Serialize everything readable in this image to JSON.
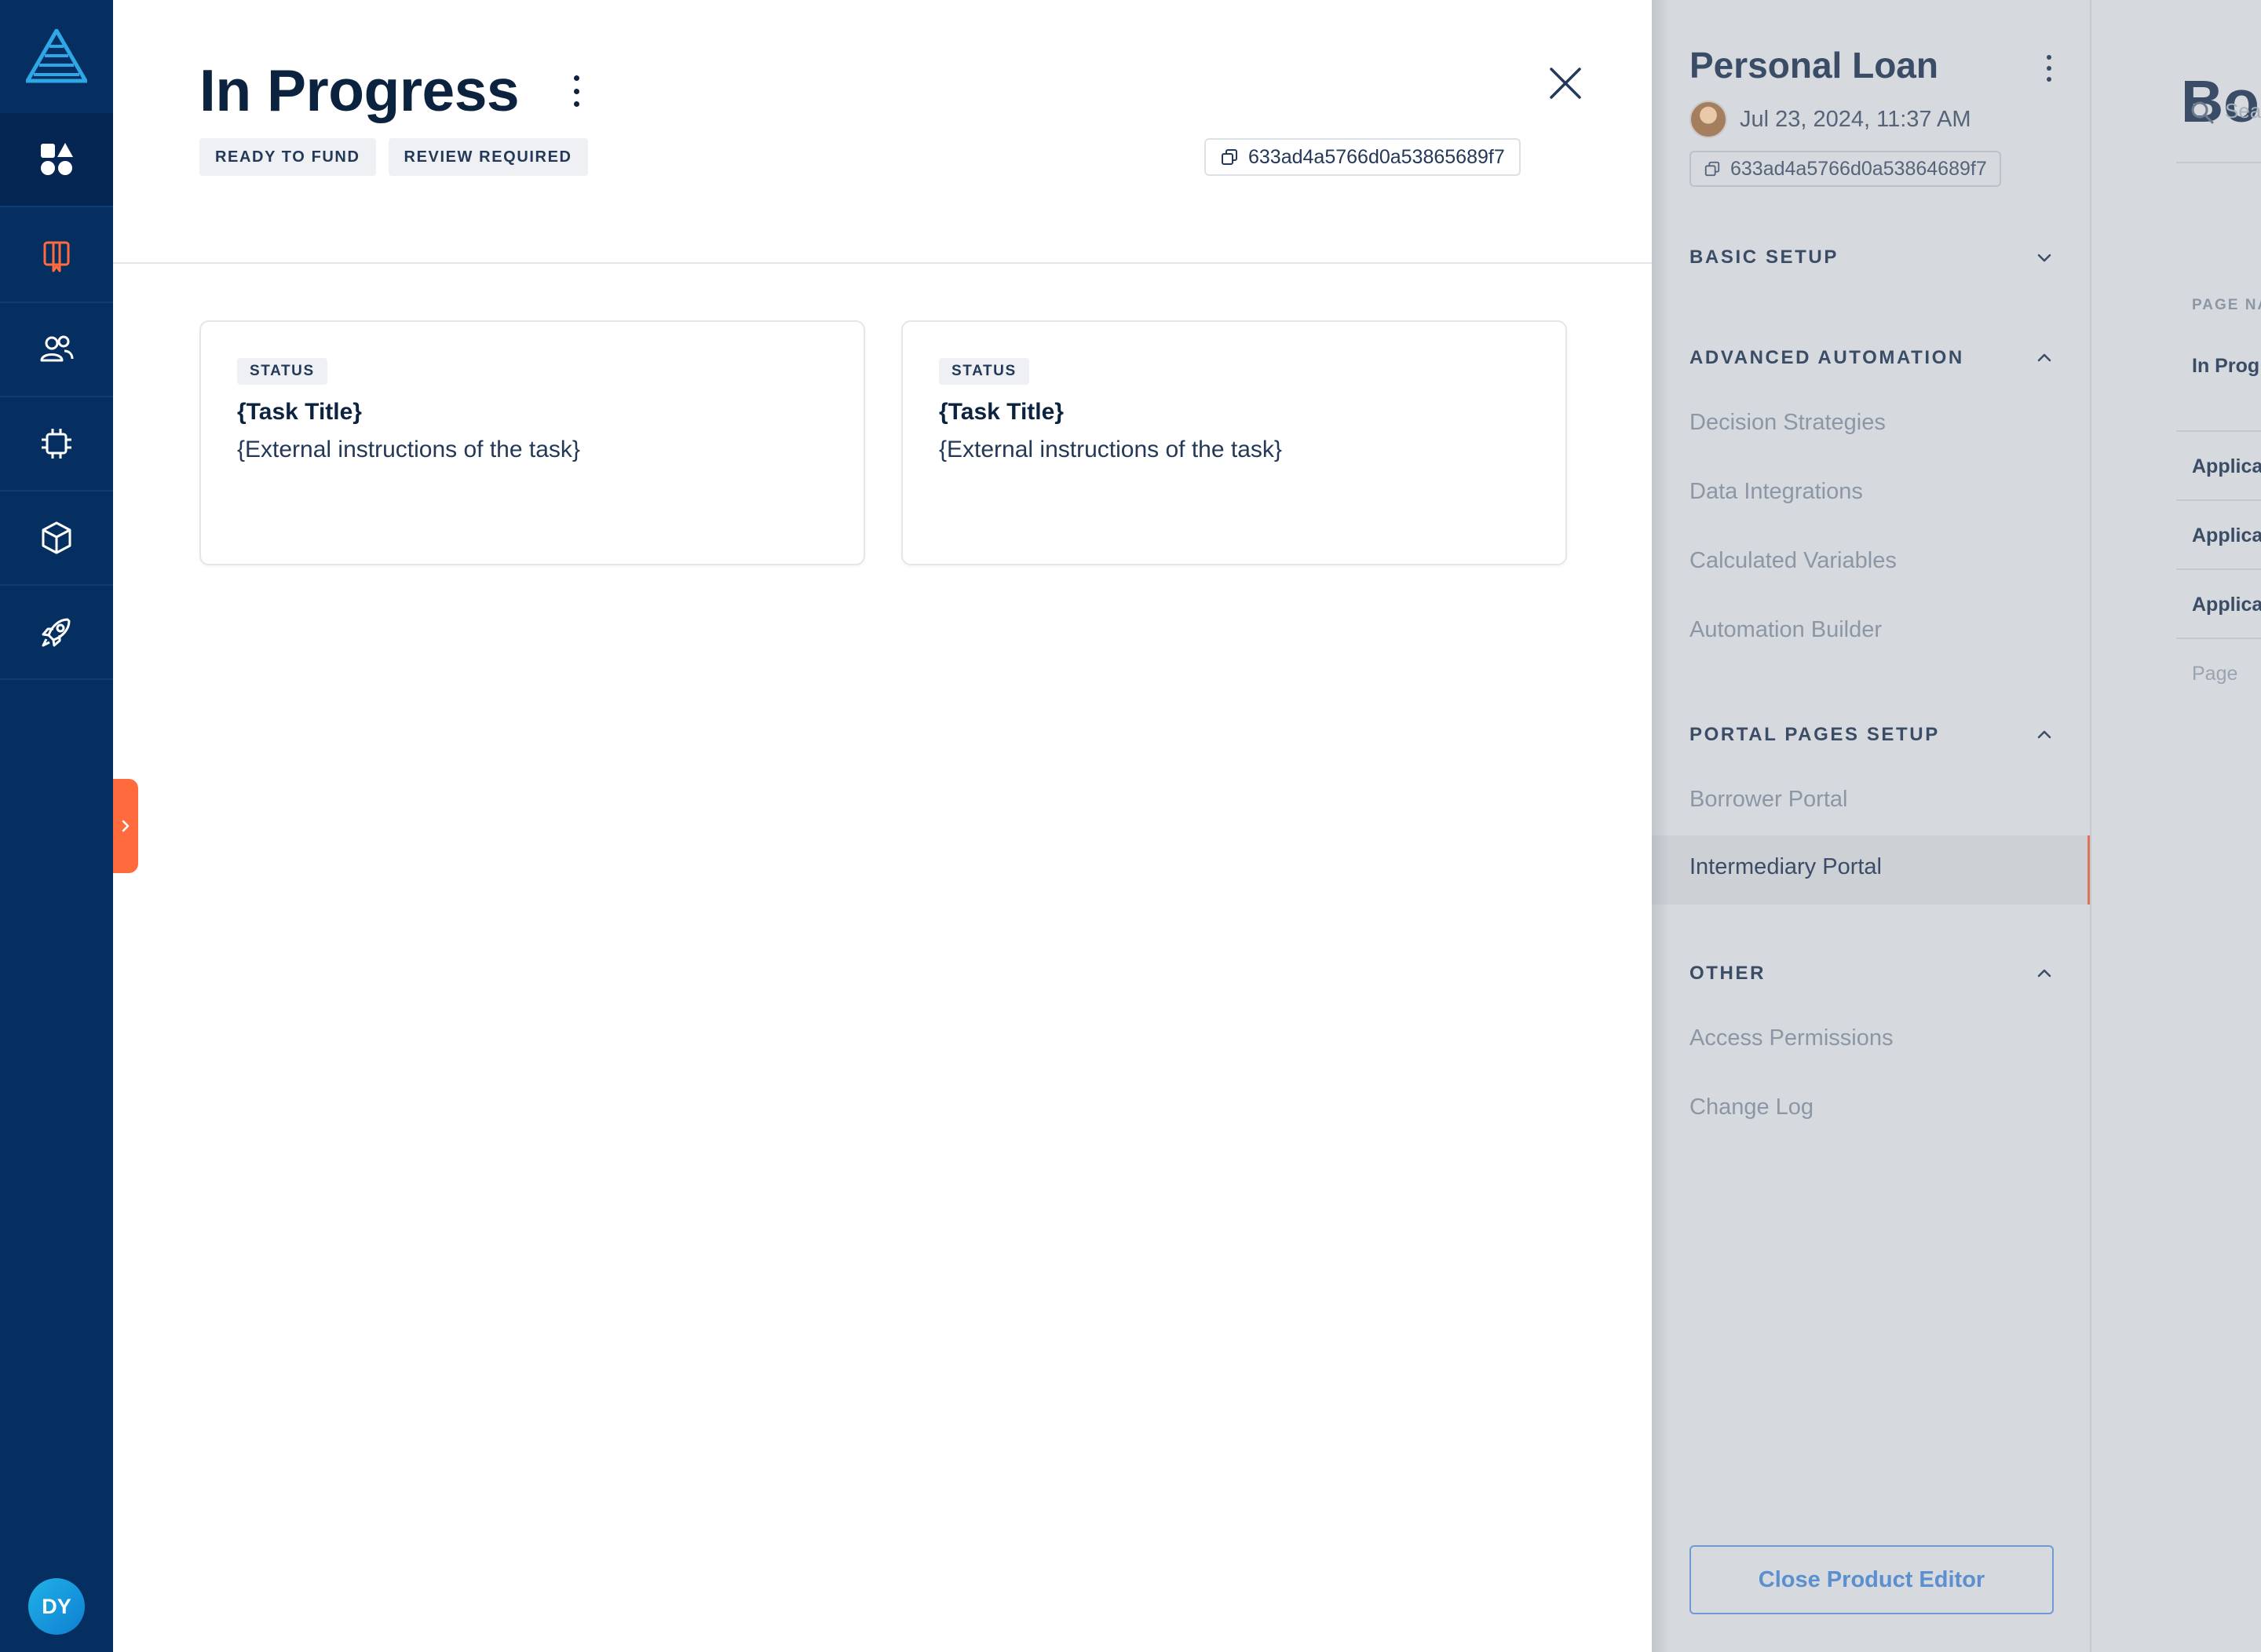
{
  "user": {
    "initials": "DY"
  },
  "modal": {
    "title": "In Progress",
    "badges": [
      "READY TO FUND",
      "REVIEW REQUIRED"
    ],
    "id": "633ad4a5766d0a53865689f7",
    "cards": [
      {
        "status": "STATUS",
        "title": "{Task Title}",
        "description": "{External instructions of the task}"
      },
      {
        "status": "STATUS",
        "title": "{Task Title}",
        "description": "{External instructions of the task}"
      }
    ]
  },
  "editor": {
    "title": "Personal Loan",
    "date": "Jul 23, 2024, 11:37 AM",
    "id": "633ad4a5766d0a53864689f7",
    "sections": {
      "basic": {
        "label": "BASIC SETUP",
        "expanded": false
      },
      "advanced": {
        "label": "ADVANCED AUTOMATION",
        "expanded": true,
        "items": [
          "Decision Strategies",
          "Data Integrations",
          "Calculated Variables",
          "Automation Builder"
        ]
      },
      "portal": {
        "label": "PORTAL PAGES SETUP",
        "expanded": true,
        "items": [
          "Borrower Portal",
          "Intermediary Portal"
        ],
        "active": "Intermediary Portal"
      },
      "other": {
        "label": "OTHER",
        "expanded": true,
        "items": [
          "Access Permissions",
          "Change Log"
        ]
      }
    },
    "close_button": "Close Product Editor"
  },
  "board": {
    "title": "Bo",
    "search_placeholder": "Sea",
    "column_header": "PAGE NA",
    "rows": [
      "In Prog",
      "Applica",
      "Applica",
      "Applica"
    ],
    "footer_text": "Page"
  },
  "colors": {
    "rail": "#062f61",
    "accent": "#ff6b3d",
    "text_dark": "#0c2340",
    "link_blue": "#5b8fcf"
  }
}
